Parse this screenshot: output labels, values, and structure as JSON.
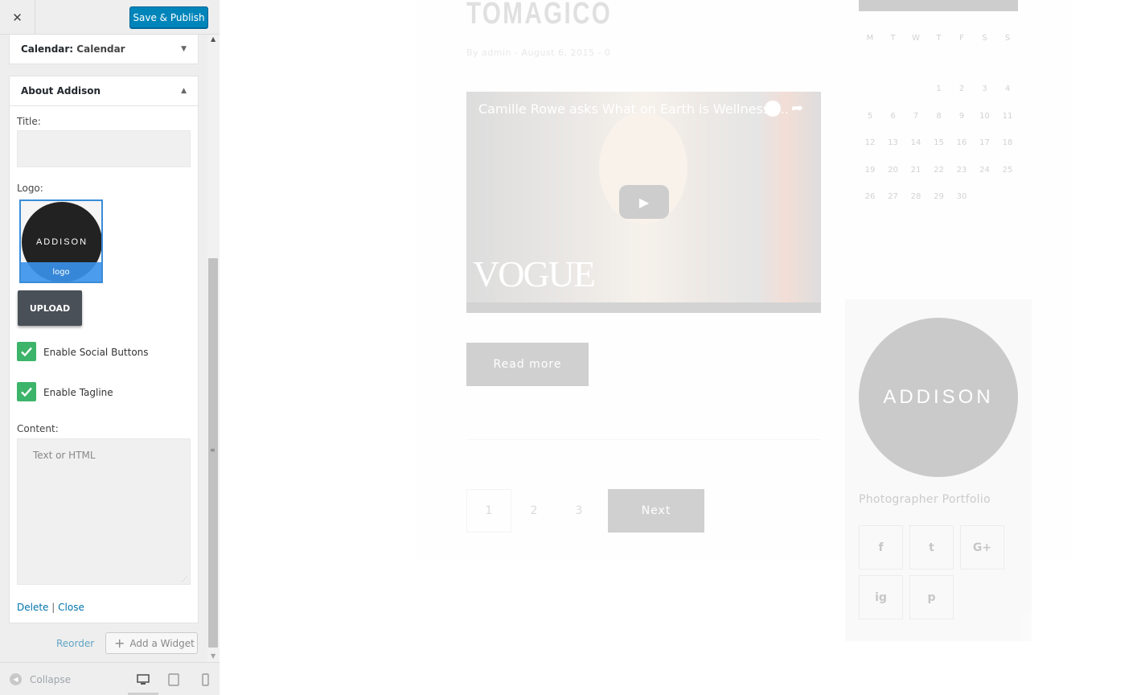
{
  "topbar": {
    "close_label": "✕",
    "publish_label": "Save & Publish"
  },
  "widgets": {
    "calendar": {
      "name": "Calendar:",
      "title": "Calendar"
    },
    "about": {
      "name": "About Addison",
      "title_label": "Title:",
      "title_value": "",
      "logo_label": "Logo:",
      "logo_text": "ADDISON",
      "logo_caption": "logo",
      "upload_label": "UPLOAD",
      "enable_social_label": "Enable Social Buttons",
      "enable_social_checked": true,
      "enable_tagline_label": "Enable Tagline",
      "enable_tagline_checked": true,
      "content_label": "Content:",
      "content_placeholder": "Text or HTML",
      "delete_label": "Delete",
      "link_separator": "|",
      "close_label": "Close"
    }
  },
  "panel_footer": {
    "reorder_label": "Reorder",
    "add_widget_label": "Add a Widget"
  },
  "footer": {
    "collapse_label": "Collapse",
    "active_device": "desktop"
  },
  "preview": {
    "post_title": "TOMAGICO",
    "post_meta": "By admin - August 6, 2015 - 0",
    "video": {
      "title": "Camille Rowe asks What on Earth is Wellness?...",
      "brand": "VOGUE"
    },
    "read_more_label": "Read more",
    "pagination": {
      "pages": [
        "1",
        "2",
        "3"
      ],
      "next_label": "Next"
    },
    "calendar": {
      "weekdays": [
        "M",
        "T",
        "W",
        "T",
        "F",
        "S",
        "S"
      ],
      "weeks": [
        [
          "",
          "",
          "",
          "1",
          "2",
          "3",
          "4"
        ],
        [
          "5",
          "6",
          "7",
          "8",
          "9",
          "10",
          "11"
        ],
        [
          "12",
          "13",
          "14",
          "15",
          "16",
          "17",
          "18"
        ],
        [
          "19",
          "20",
          "21",
          "22",
          "23",
          "24",
          "25"
        ],
        [
          "26",
          "27",
          "28",
          "29",
          "30",
          "",
          ""
        ]
      ]
    },
    "about": {
      "logo_text": "ADDISON",
      "tagline": "Photographer Portfolio",
      "social": [
        "f",
        "t",
        "G+",
        "ig",
        "p"
      ]
    }
  },
  "colors": {
    "primary": "#0085ba",
    "check": "#3cb46a",
    "link": "#0073aa",
    "logo_bg": "#222222"
  }
}
